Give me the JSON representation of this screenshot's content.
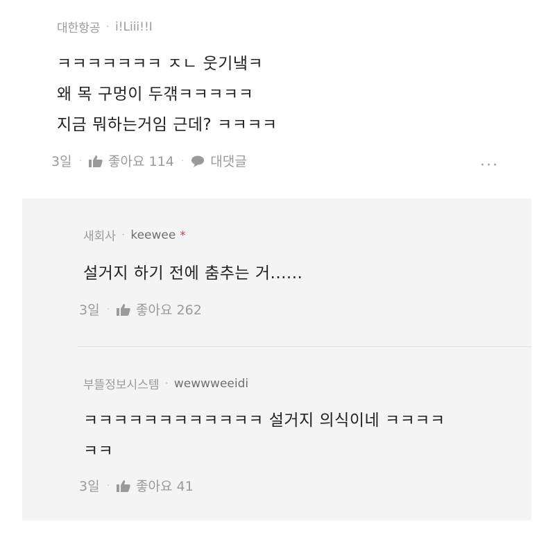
{
  "comment": {
    "nickname": "대한항공",
    "user_id": "i!Liii!!I",
    "lines": [
      "ㅋㅋㅋㅋㅋㅋㅋ ㅈㄴ 웃기냌ㅋ",
      "왜 목 구멍이 두갞ㅋㅋㅋㅋㅋ",
      "지금 뭐하는거임 근데? ㅋㅋㅋㅋ"
    ],
    "time": "3일",
    "like_label": "좋아요 114",
    "reply_label": "대댓글",
    "more_label": "···"
  },
  "replies": [
    {
      "nickname": "새회사",
      "user_id": "keewee",
      "badge": "*",
      "lines": [
        "설거지 하기 전에 춤추는 거......"
      ],
      "time": "3일",
      "like_label": "좋아요 262"
    },
    {
      "nickname": "부뜰정보시스템",
      "user_id": "wewwweeidi",
      "lines": [
        "ㅋㅋㅋㅋㅋㅋㅋㅋㅋㅋㅋㅋ 설거지 의식이네 ㅋㅋㅋㅋ",
        "ㅋㅋ"
      ],
      "time": "3일",
      "like_label": "좋아요 41"
    }
  ],
  "icons": {
    "dot": "·",
    "like": "thumbs-up-icon",
    "reply": "speech-bubble-icon"
  },
  "colors": {
    "meta_text": "#9a9a9a",
    "body_text": "#222222",
    "reply_bg": "#f4f4f4",
    "star": "#e0322b"
  }
}
